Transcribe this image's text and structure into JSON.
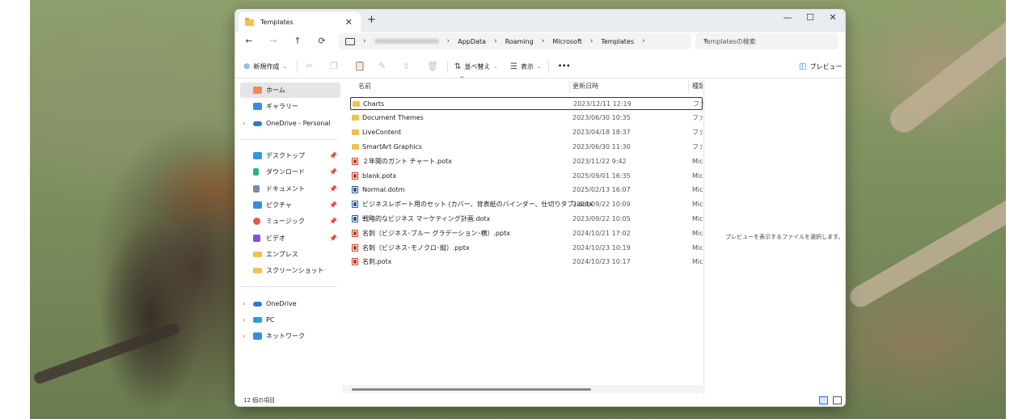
{
  "window": {
    "tab_title": "Templates",
    "tab_close": "✕",
    "new_tab": "+",
    "controls": {
      "minimize": "—",
      "maximize": "☐",
      "close": "✕"
    }
  },
  "nav": {
    "back": "←",
    "forward": "→",
    "up": "↑",
    "refresh": "⟳"
  },
  "address": {
    "segments": [
      "AppData",
      "Roaming",
      "Microsoft",
      "Templates"
    ]
  },
  "search": {
    "placeholder": "Templatesの検索"
  },
  "toolbar": {
    "new_label": "新規作成",
    "sort_label": "並べ替え",
    "view_label": "表示",
    "more_label": "•••",
    "preview_label": "プレビュー"
  },
  "sidebar": {
    "items": [
      {
        "label": "ホーム",
        "icon": "home-icon"
      },
      {
        "label": "ギャラリー",
        "icon": "gallery-icon"
      },
      {
        "label": "OneDrive - Personal",
        "icon": "cloud-icon"
      },
      {
        "label": "デスクトップ",
        "icon": "desktop-icon"
      },
      {
        "label": "ダウンロード",
        "icon": "download-icon"
      },
      {
        "label": "ドキュメント",
        "icon": "documents-icon"
      },
      {
        "label": "ピクチャ",
        "icon": "pictures-icon"
      },
      {
        "label": "ミュージック",
        "icon": "music-icon"
      },
      {
        "label": "ビデオ",
        "icon": "videos-icon"
      },
      {
        "label": "エンプレス",
        "icon": "folder-icon"
      },
      {
        "label": "スクリーンショット",
        "icon": "folder-icon"
      },
      {
        "label": "OneDrive",
        "icon": "cloud-icon"
      },
      {
        "label": "PC",
        "icon": "pc-icon"
      },
      {
        "label": "ネットワーク",
        "icon": "network-icon"
      }
    ]
  },
  "columns": {
    "name": "名前",
    "modified": "更新日時",
    "type": "種類"
  },
  "files": [
    {
      "name": "Charts",
      "date": "2023/12/11 12:19",
      "type": "ファイル フォルダー",
      "kind": "folder"
    },
    {
      "name": "Document Themes",
      "date": "2023/06/30 10:35",
      "type": "ファイル フォルダー",
      "kind": "folder"
    },
    {
      "name": "LiveContent",
      "date": "2023/04/18 18:37",
      "type": "ファイル フォルダー",
      "kind": "folder"
    },
    {
      "name": "SmartArt Graphics",
      "date": "2023/06/30 11:30",
      "type": "ファイル フォルダー",
      "kind": "folder"
    },
    {
      "name": "２年間のガント チャート.potx",
      "date": "2023/11/22 9:42",
      "type": "Microsoft",
      "kind": "ppt"
    },
    {
      "name": "blank.potx",
      "date": "2025/09/01 16:35",
      "type": "Microsoft",
      "kind": "ppt"
    },
    {
      "name": "Normal.dotm",
      "date": "2025/02/13 16:07",
      "type": "Microsoft",
      "kind": "word"
    },
    {
      "name": "ビジネスレポート用のセット (カバー、背表紙のバインダー、仕切りタブ).dotx",
      "date": "2023/09/22 10:09",
      "type": "Microsoft",
      "kind": "word"
    },
    {
      "name": "戦略的なビジネス マーケティング計画.dotx",
      "date": "2023/09/22 10:05",
      "type": "Microsoft",
      "kind": "word"
    },
    {
      "name": "名刺（ビジネス･ブルー グラデーション･横）.pptx",
      "date": "2024/10/21 17:02",
      "type": "Microsoft",
      "kind": "ppt"
    },
    {
      "name": "名刺（ビジネス･モノクロ･縦）.pptx",
      "date": "2024/10/23 10:19",
      "type": "Microsoft",
      "kind": "ppt"
    },
    {
      "name": "名刺.potx",
      "date": "2024/10/23 10:17",
      "type": "Microsoft",
      "kind": "ppt"
    }
  ],
  "preview_text": "プレビューを表示するファイルを選択します。",
  "status_text": "12 個の項目",
  "colors": {
    "accent": "#2b6fc7",
    "folder": "#f2c14e"
  }
}
